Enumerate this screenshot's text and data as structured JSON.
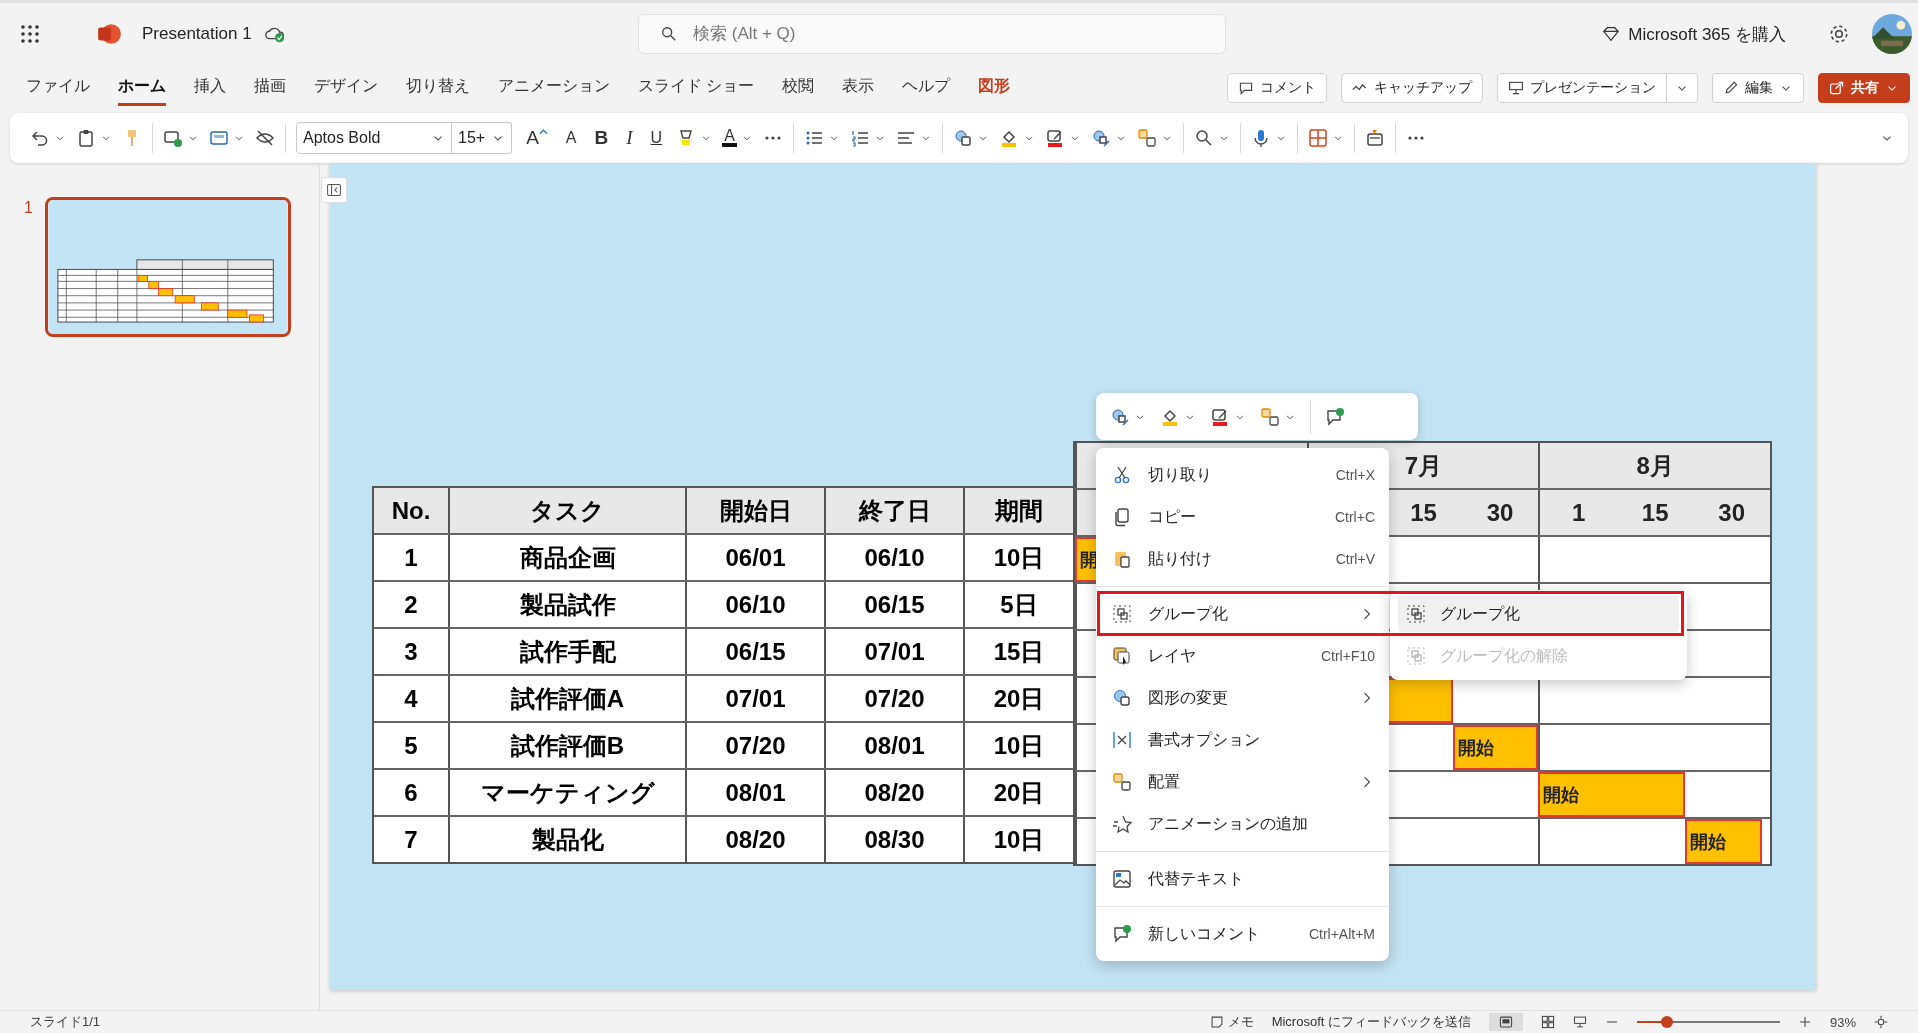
{
  "app": {
    "title": "Presentation 1",
    "search": {
      "placeholder": "検索 (Alt + Q)"
    },
    "buy": "Microsoft 365 を購入"
  },
  "tabs": [
    {
      "label": "ファイル",
      "selected": false,
      "kind": "normal"
    },
    {
      "label": "ホーム",
      "selected": true,
      "kind": "normal"
    },
    {
      "label": "挿入",
      "selected": false,
      "kind": "normal"
    },
    {
      "label": "描画",
      "selected": false,
      "kind": "normal"
    },
    {
      "label": "デザイン",
      "selected": false,
      "kind": "normal"
    },
    {
      "label": "切り替え",
      "selected": false,
      "kind": "normal"
    },
    {
      "label": "アニメーション",
      "selected": false,
      "kind": "normal"
    },
    {
      "label": "スライド ショー",
      "selected": false,
      "kind": "normal"
    },
    {
      "label": "校閲",
      "selected": false,
      "kind": "normal"
    },
    {
      "label": "表示",
      "selected": false,
      "kind": "normal"
    },
    {
      "label": "ヘルプ",
      "selected": false,
      "kind": "normal"
    },
    {
      "label": "図形",
      "selected": false,
      "kind": "contextual"
    }
  ],
  "actions": [
    {
      "label": "コメント",
      "kind": "comment"
    },
    {
      "label": "キャッチアップ",
      "kind": "catchup"
    },
    {
      "label": "プレゼンテーション",
      "kind": "present"
    },
    {
      "label": "編集",
      "kind": "edit"
    },
    {
      "label": "共有",
      "kind": "share"
    }
  ],
  "ribbon": {
    "font": "Aptos Bold",
    "size": "15+",
    "grow": "A",
    "shrink": "A",
    "styles": [
      "B",
      "I",
      "U"
    ],
    "color_letter": "A"
  },
  "slides": [
    {
      "number": "1",
      "selected": true
    }
  ],
  "table": {
    "columns": [
      "No.",
      "タスク",
      "開始日",
      "終了日",
      "期間"
    ],
    "rows": [
      {
        "cells": [
          "1",
          "商品企画",
          "06/01",
          "06/10",
          "10日"
        ],
        "bar": true,
        "bar_label": "開"
      },
      {
        "cells": [
          "2",
          "製品試作",
          "06/10",
          "06/15",
          "5日"
        ],
        "bar": false
      },
      {
        "cells": [
          "3",
          "試作手配",
          "06/15",
          "07/01",
          "15日"
        ],
        "bar": false
      },
      {
        "cells": [
          "4",
          "試作評価A",
          "07/01",
          "07/20",
          "20日"
        ],
        "bar": true
      },
      {
        "cells": [
          "5",
          "試作評価B",
          "07/20",
          "08/01",
          "10日"
        ],
        "bar": true,
        "bar_label": "開始"
      },
      {
        "cells": [
          "6",
          "マーケティング",
          "08/01",
          "08/20",
          "20日"
        ],
        "bar": true,
        "bar_label": "開始"
      },
      {
        "cells": [
          "7",
          "製品化",
          "08/20",
          "08/30",
          "10日"
        ],
        "bar": true,
        "bar_label": "開始"
      }
    ]
  },
  "gantt": {
    "months": [
      {
        "label": "7月",
        "days": [
          "15",
          "30"
        ]
      },
      {
        "label": "8月",
        "days": [
          "1",
          "15",
          "30"
        ]
      }
    ]
  },
  "context_menu": {
    "groups": [
      [
        {
          "label": "切り取り",
          "shortcut": "Ctrl+X",
          "kind": "cut",
          "submenu": false
        },
        {
          "label": "コピー",
          "shortcut": "Ctrl+C",
          "kind": "copy",
          "submenu": false
        },
        {
          "label": "貼り付け",
          "shortcut": "Ctrl+V",
          "kind": "paste",
          "submenu": false
        }
      ],
      [
        {
          "label": "グループ化",
          "kind": "group",
          "submenu": true
        },
        {
          "label": "レイヤ",
          "shortcut": "Ctrl+F10",
          "kind": "layer",
          "submenu": false
        },
        {
          "label": "図形の変更",
          "kind": "shape",
          "submenu": true
        },
        {
          "label": "書式オプション",
          "kind": "format",
          "submenu": false
        },
        {
          "label": "配置",
          "kind": "arrange",
          "submenu": true
        },
        {
          "label": "アニメーションの追加",
          "kind": "animation",
          "submenu": false
        }
      ],
      [
        {
          "label": "代替テキスト",
          "kind": "alttext",
          "submenu": false
        }
      ],
      [
        {
          "label": "新しいコメント",
          "shortcut": "Ctrl+Alt+M",
          "kind": "newcomment",
          "submenu": false
        }
      ]
    ],
    "submenu": [
      {
        "label": "グループ化",
        "selected": true,
        "disabled": false
      },
      {
        "label": "グループ化の解除",
        "selected": false,
        "disabled": true
      }
    ]
  },
  "status": {
    "slide": "スライド1/1",
    "notes": "メモ",
    "feedback": "Microsoft にフィードバックを送信",
    "zoom": {
      "level": 0.21,
      "reading": "93%"
    }
  }
}
